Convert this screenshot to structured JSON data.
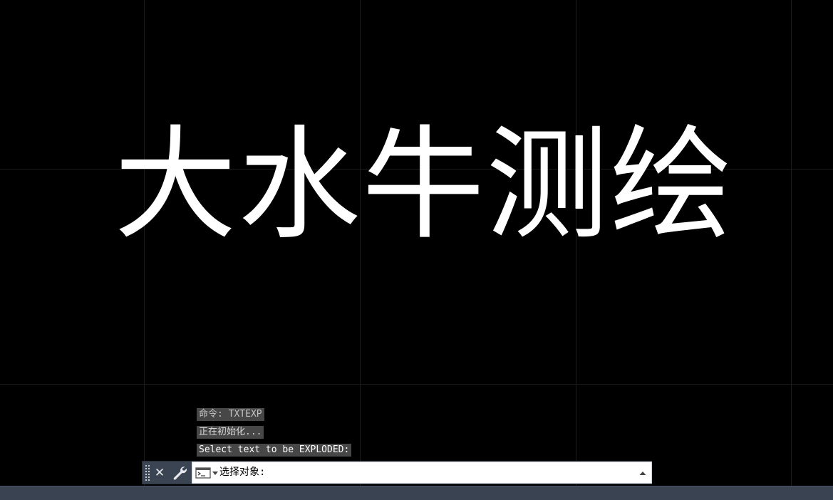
{
  "canvas": {
    "drawing_text": "大水牛测绘",
    "background_color": "#000000",
    "text_color": "#ffffff",
    "grid_color": "#1c1c1c"
  },
  "command_history": [
    "命令: TXTEXP",
    "正在初始化...",
    "Select text to be EXPLODED:"
  ],
  "command_line": {
    "close_icon": "close-icon",
    "close_glyph": "✕",
    "settings_icon": "wrench-icon",
    "prompt_icon": "command-prompt-icon",
    "prompt": "选择对象:",
    "input_value": "",
    "history_icon": "triangle-up-icon",
    "bar_color": "#3b4453"
  },
  "status_bar": {
    "color": "#3a4352"
  }
}
